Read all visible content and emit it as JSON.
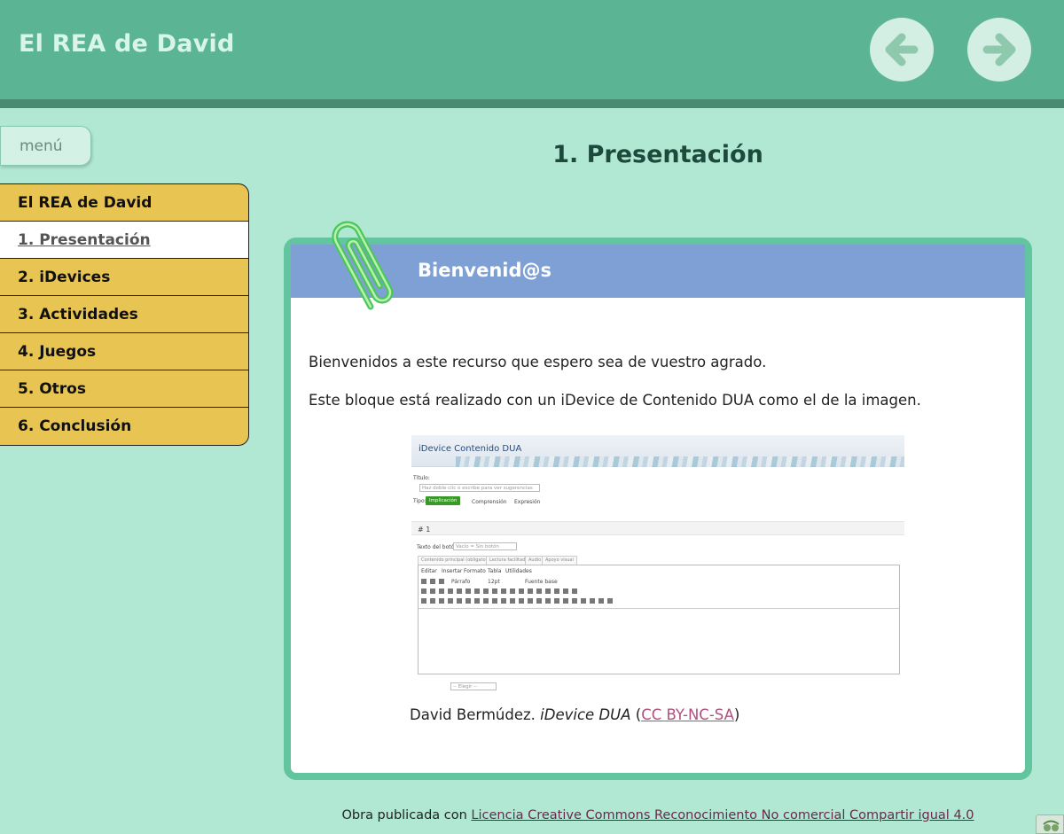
{
  "site": {
    "title": "El REA de David"
  },
  "nav_buttons": {
    "prev_icon": "arrow-left-icon",
    "next_icon": "arrow-right-icon"
  },
  "menu": {
    "toggle_label": "menú",
    "items": [
      {
        "label": "El REA de David",
        "active": false
      },
      {
        "label": "1. Presentación",
        "active": true
      },
      {
        "label": "2. iDevices",
        "active": false
      },
      {
        "label": "3. Actividades",
        "active": false
      },
      {
        "label": "4. Juegos",
        "active": false
      },
      {
        "label": "5. Otros",
        "active": false
      },
      {
        "label": "6. Conclusión",
        "active": false
      }
    ]
  },
  "page": {
    "title": "1. Presentación"
  },
  "idevice": {
    "title": "Bienvenid@s",
    "icon": "paperclip-icon",
    "paragraphs": [
      "Bienvenidos a este recurso que espero sea de vuestro agrado.",
      "Este bloque está realizado con un iDevice de Contenido DUA como el de la imagen."
    ],
    "screenshot": {
      "banner_title": "iDevice Contenido DUA",
      "titulo_label": "Título:",
      "titulo_placeholder": "Haz doble clic o escribe para ver sugerencias",
      "tipo_label": "Tipo:",
      "tipo_options": [
        "Implicación",
        "Comprensión",
        "Expresión"
      ],
      "section_number": "# 1",
      "boton_label": "Texto del botón:",
      "boton_value": "Vacío = Sin botón",
      "tabs": [
        "Contenido principal (obligatorio)",
        "Lectura facilitada",
        "Audio",
        "Apoyo visual"
      ],
      "menus": [
        "Editar",
        "Insertar",
        "Formato",
        "Tabla",
        "Utilidades"
      ],
      "paragraph_select": "Párrafo",
      "size_select": "12pt",
      "font_select": "Fuente base",
      "bottom_select": "-- Elegir --"
    },
    "caption": {
      "author": "David Bermúdez.",
      "work": "iDevice DUA",
      "open": " (",
      "license": "CC BY-NC-SA",
      "close": ")"
    }
  },
  "footer": {
    "prefix": "Obra publicada con ",
    "license_link": "Licencia Creative Commons Reconocimiento No comercial Compartir igual 4.0"
  },
  "colors": {
    "header": "#5bb595",
    "background": "#b0e8d4",
    "menu": "#e8c452",
    "idevice_border": "#63c59f",
    "idevice_header": "#7fa0d5"
  }
}
